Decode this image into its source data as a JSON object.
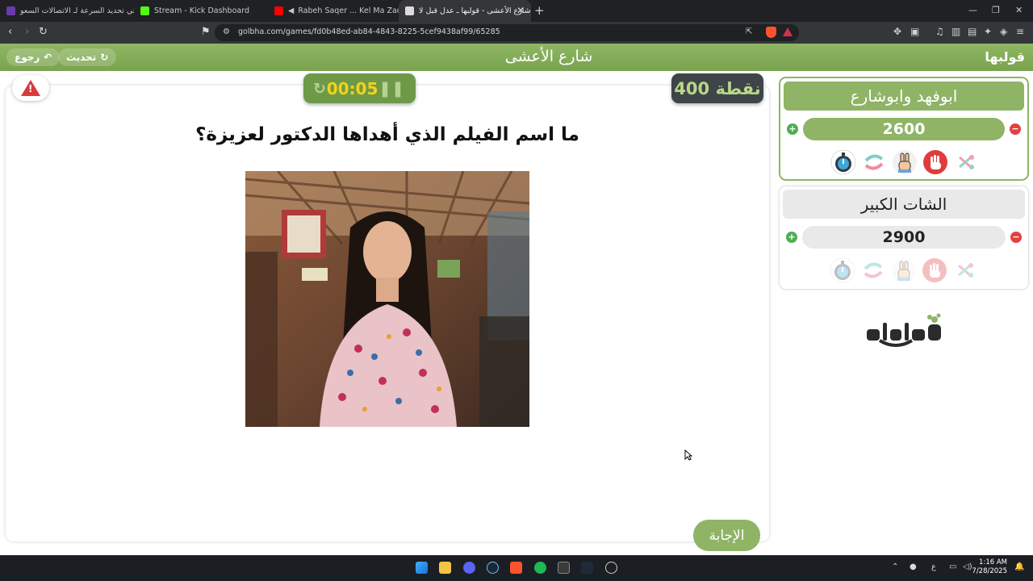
{
  "browser": {
    "tabs": [
      {
        "title": "تخطي تحديد السرعة لـ الاتصالات السعو",
        "favicon_color": "#6a3ba8"
      },
      {
        "title": "Stream - Kick Dashboard",
        "favicon_color": "#53fc18"
      },
      {
        "title": "Rabeh Saqer ... Kel Ma Zad - Wit",
        "favicon_color": "#ff0000"
      },
      {
        "title": "شارع الأعشى - قولبها ـ عدل قبل لا",
        "favicon_color": "#dcdcdc"
      }
    ],
    "url": "golbha.com/games/fd0b48ed-ab84-4843-8225-5cef9438af99/65285"
  },
  "app": {
    "title": "شارع الأعشى",
    "back_label": "رجوع",
    "refresh_label": "تحديث",
    "logo_text": "قولبها",
    "accent": "#8fb466"
  },
  "game": {
    "timer": "00:05",
    "points": "400 نقطة",
    "question": "ما اسم الفيلم الذي أهداها الدكتور لعزيزة؟",
    "answer_label": "الإجابة"
  },
  "teams": [
    {
      "name": "ابوفهد وابوشارع",
      "score": "2600"
    },
    {
      "name": "الشات الكبير",
      "score": "2900"
    }
  ],
  "taskbar": {
    "lang": "ع",
    "time": "1:16 AM",
    "date": "7/28/2025"
  }
}
